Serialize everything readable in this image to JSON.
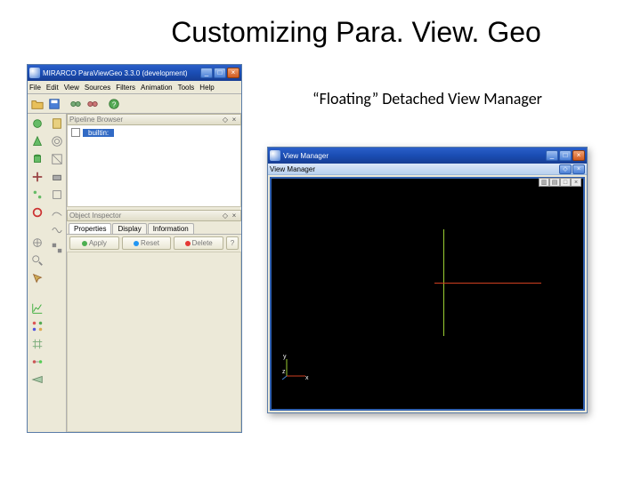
{
  "slide": {
    "title": "Customizing Para. View. Geo",
    "caption": "“Floating” Detached View Manager"
  },
  "app": {
    "title": "MIRARCO ParaViewGeo 3.3.0 (development)",
    "menu": [
      "File",
      "Edit",
      "View",
      "Sources",
      "Filters",
      "Animation",
      "Tools",
      "Help"
    ],
    "pipeline": {
      "header": "Pipeline Browser",
      "item": "builtin:"
    },
    "inspector": {
      "header": "Object Inspector",
      "tabs": [
        "Properties",
        "Display",
        "Information"
      ],
      "buttons": {
        "apply": "Apply",
        "reset": "Reset",
        "delete": "Delete",
        "help": "?"
      }
    }
  },
  "viewmgr": {
    "title": "View Manager",
    "axis": {
      "x": "x",
      "y": "y",
      "z": "z"
    }
  }
}
